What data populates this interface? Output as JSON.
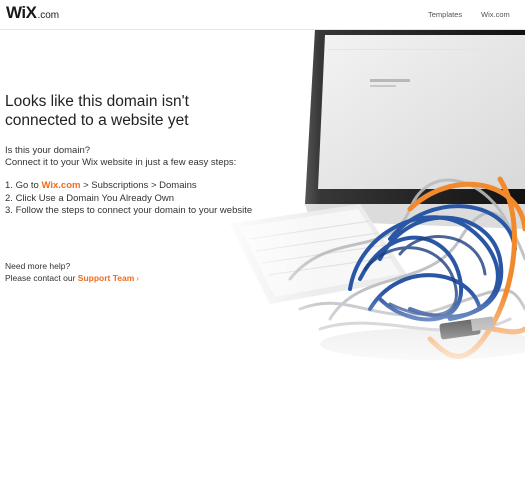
{
  "header": {
    "logo_main": "WiX",
    "logo_tld": ".com",
    "nav": {
      "templates": "Templates",
      "wix": "Wix.com"
    }
  },
  "main": {
    "headline_line1": "Looks like this domain isn't",
    "headline_line2": "connected to a website yet",
    "question": "Is this your domain?",
    "intro": "Connect it to your Wix website in just a few easy steps:",
    "steps": [
      {
        "number": "1.",
        "prefix": "Go to",
        "link": "Wix.com",
        "suffix": "> Subscriptions > Domains"
      },
      {
        "number": "2.",
        "text": "Click Use a Domain You Already Own"
      },
      {
        "number": "3.",
        "text": "Follow the steps to connect your domain to your website"
      }
    ],
    "help_title": "Need more help?",
    "help_prefix": "Please contact our",
    "help_link": "Support Team",
    "help_chevron": "›"
  },
  "colors": {
    "accent": "#f26b1d",
    "text": "#333333",
    "cable_blue": "#2a56a6",
    "cable_orange": "#f08a2c"
  },
  "icons": {
    "illustration": "tangled-cables-and-monitor-illustration"
  }
}
